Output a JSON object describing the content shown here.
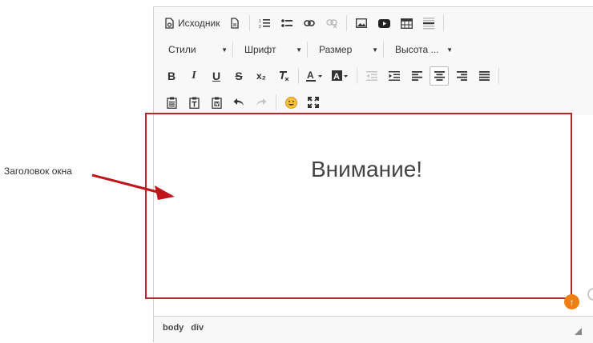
{
  "annotation": {
    "label": "Заголовок окна"
  },
  "toolbar": {
    "source_label": "Исходник",
    "combos": {
      "styles": "Стили",
      "font": "Шрифт",
      "size": "Размер",
      "line_height": "Высота ..."
    },
    "bold": "B",
    "italic": "I",
    "underline": "U",
    "strike": "S",
    "subscript": "x₂",
    "clear_format": "T"
  },
  "content": {
    "heading": "Внимание!"
  },
  "statusbar": {
    "path": [
      "body",
      "div"
    ]
  },
  "colors": {
    "annotation_box": "#b3262d",
    "accent": "#f07f13"
  }
}
